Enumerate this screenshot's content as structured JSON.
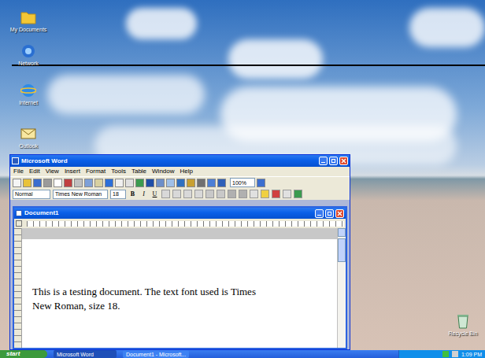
{
  "desktop_icons": [
    {
      "label": "My Documents"
    },
    {
      "label": "Network"
    },
    {
      "label": "Internet"
    },
    {
      "label": "Outlook"
    }
  ],
  "recycle_bin": {
    "label": "Recycle Bin"
  },
  "word_window": {
    "title": "Microsoft Word",
    "menu": [
      "File",
      "Edit",
      "View",
      "Insert",
      "Format",
      "Tools",
      "Table",
      "Window",
      "Help"
    ],
    "toolbar": {
      "style": "Normal",
      "font": "Times New Roman",
      "size": "18",
      "zoom": "100%",
      "format_buttons": [
        "B",
        "I",
        "U"
      ]
    }
  },
  "document": {
    "title": "Document1",
    "lines": [
      "This is a testing document. The text font used is Times",
      "New Roman, size 18."
    ]
  },
  "taskbar": {
    "start": "start",
    "tasks": [
      {
        "label": "Microsoft Word",
        "selected": true
      },
      {
        "label": "Document1 - Microsoft...",
        "selected": false
      }
    ],
    "clock": "1:09 PM"
  }
}
